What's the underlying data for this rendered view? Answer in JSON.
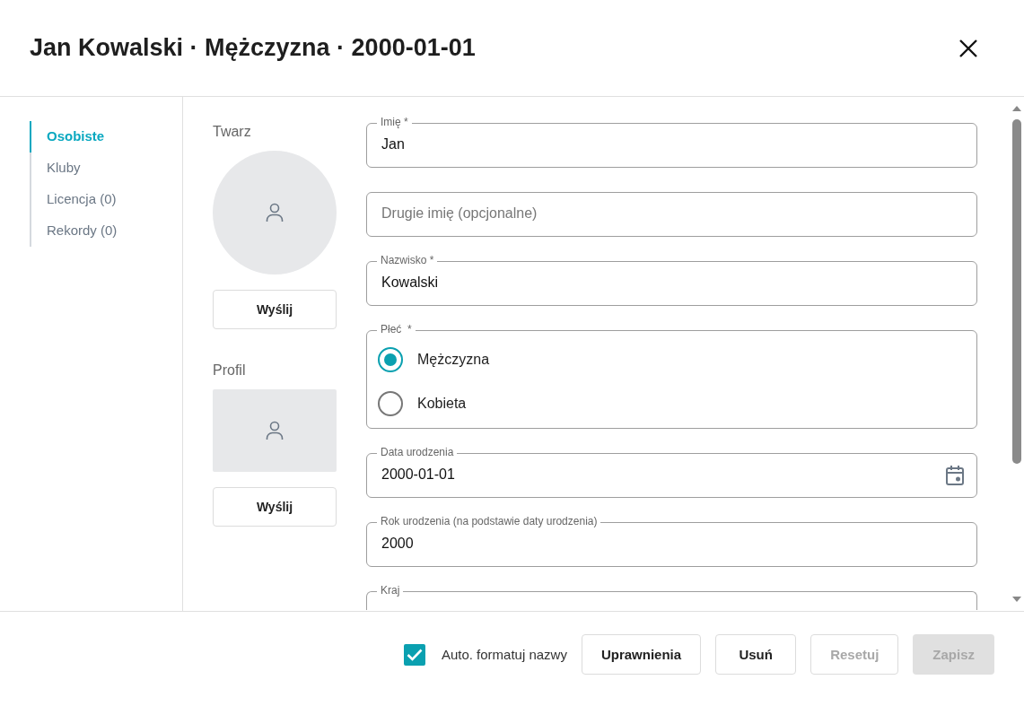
{
  "dialog": {
    "title": "Jan Kowalski · Mężczyzna · 2000-01-01"
  },
  "nav": [
    {
      "label": "Osobiste",
      "selected": true
    },
    {
      "label": "Kluby",
      "selected": false
    },
    {
      "label": "Licencja (0)",
      "selected": false
    },
    {
      "label": "Rekordy (0)",
      "selected": false
    }
  ],
  "images": [
    {
      "label": "Twarz",
      "kind": "circle",
      "button": "Wyślij"
    },
    {
      "label": "Profil",
      "kind": "rect",
      "button": "Wyślij"
    }
  ],
  "fields": [
    {
      "kind": "text",
      "label": "Imię *",
      "value": "Jan"
    },
    {
      "kind": "text",
      "placeholder": "Drugie imię (opcjonalne)"
    },
    {
      "kind": "text",
      "label": "Nazwisko *",
      "value": "Kowalski"
    },
    {
      "kind": "radio",
      "label": "Płeć  *",
      "options": [
        {
          "label": "Mężczyzna",
          "selected": true
        },
        {
          "label": "Kobieta",
          "selected": false
        }
      ]
    },
    {
      "kind": "date",
      "label": "Data urodzenia",
      "value": "2000-01-01"
    },
    {
      "kind": "text",
      "label": "Rok urodzenia (na podstawie daty urodzenia)",
      "value": "2000"
    },
    {
      "kind": "select",
      "label": "Kraj"
    }
  ],
  "footer": {
    "auto_format": {
      "label": "Auto. formatuj nazwy",
      "checked": true
    },
    "buttons": [
      {
        "label": "Uprawnienia",
        "kind": "outlined",
        "disabled": false
      },
      {
        "label": "Usuń",
        "kind": "outlined",
        "disabled": false
      },
      {
        "label": "Resetuj",
        "kind": "outlined",
        "disabled": true
      },
      {
        "label": "Zapisz",
        "kind": "contained",
        "disabled": true
      }
    ]
  }
}
